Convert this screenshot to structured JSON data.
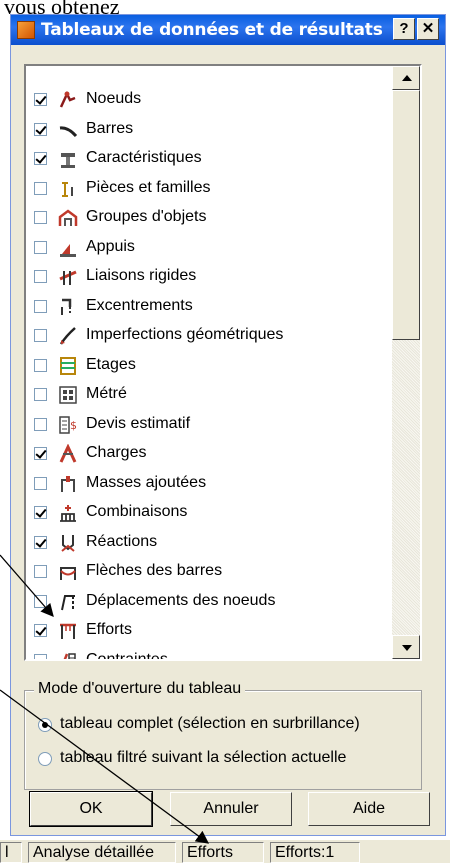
{
  "caption": "vous obtenez",
  "dialog": {
    "title": "Tableaux de données et de résultats",
    "help_label": "?",
    "close_label": "✕"
  },
  "tables": [
    {
      "label": "Noeuds",
      "checked": true,
      "icon": "nodes-icon"
    },
    {
      "label": "Barres",
      "checked": true,
      "icon": "bars-icon"
    },
    {
      "label": "Caractéristiques",
      "checked": true,
      "icon": "characteristics-icon"
    },
    {
      "label": "Pièces et familles",
      "checked": false,
      "icon": "parts-families-icon"
    },
    {
      "label": "Groupes d'objets",
      "checked": false,
      "icon": "object-groups-icon"
    },
    {
      "label": "Appuis",
      "checked": false,
      "icon": "supports-icon"
    },
    {
      "label": "Liaisons rigides",
      "checked": false,
      "icon": "rigid-links-icon"
    },
    {
      "label": "Excentrements",
      "checked": false,
      "icon": "offsets-icon"
    },
    {
      "label": "Imperfections géométriques",
      "checked": false,
      "icon": "geometric-imperfections-icon"
    },
    {
      "label": "Etages",
      "checked": false,
      "icon": "storeys-icon"
    },
    {
      "label": "Métré",
      "checked": false,
      "icon": "quantity-survey-icon"
    },
    {
      "label": "Devis estimatif",
      "checked": false,
      "icon": "cost-estimate-icon"
    },
    {
      "label": "Charges",
      "checked": true,
      "icon": "loads-icon"
    },
    {
      "label": "Masses ajoutées",
      "checked": false,
      "icon": "added-masses-icon"
    },
    {
      "label": "Combinaisons",
      "checked": true,
      "icon": "combinations-icon"
    },
    {
      "label": "Réactions",
      "checked": true,
      "icon": "reactions-icon"
    },
    {
      "label": "Flèches des barres",
      "checked": false,
      "icon": "bar-deflections-icon"
    },
    {
      "label": "Déplacements des noeuds",
      "checked": false,
      "icon": "node-displacements-icon"
    },
    {
      "label": "Efforts",
      "checked": true,
      "icon": "forces-icon"
    },
    {
      "label": "Contraintes",
      "checked": false,
      "icon": "stresses-icon"
    }
  ],
  "opening_mode": {
    "legend": "Mode d'ouverture du tableau",
    "options": [
      {
        "label": "tableau complet (sélection en surbrillance)",
        "selected": true
      },
      {
        "label": "tableau filtré suivant la sélection actuelle",
        "selected": false
      }
    ]
  },
  "buttons": {
    "ok": "OK",
    "cancel": "Annuler",
    "help": "Aide"
  },
  "statusbar": [
    "l",
    "Analyse détaillée",
    "Efforts",
    "Efforts:1"
  ],
  "colors": {
    "title_bar": "#0a5fe0",
    "dialog_bg": "#ece9d8",
    "accent_icon": "#c0392b"
  }
}
